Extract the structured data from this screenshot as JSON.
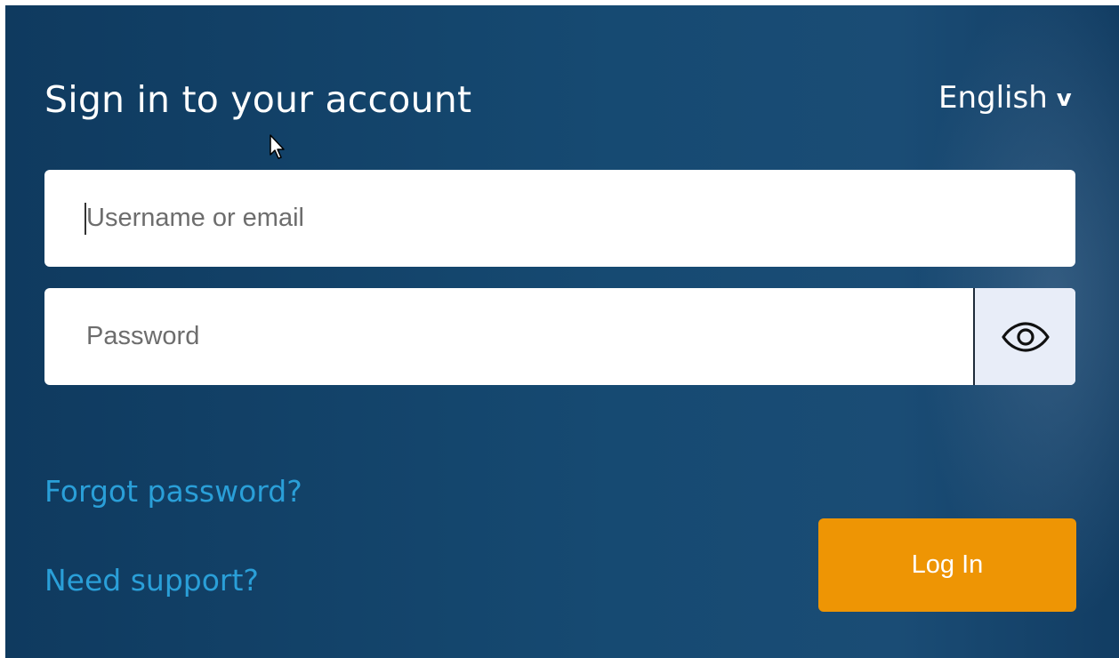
{
  "login": {
    "title": "Sign in to your account",
    "language": {
      "selected": "English",
      "chevron": "v"
    },
    "username": {
      "placeholder": "Username or email",
      "value": ""
    },
    "password": {
      "placeholder": "Password",
      "value": "",
      "toggle_icon": "eye-icon"
    },
    "links": {
      "forgot": "Forgot password?",
      "support": "Need support?"
    },
    "submit_label": "Log In"
  },
  "colors": {
    "background": "#164a72",
    "link": "#2a9fd8",
    "button": "#ee9504",
    "eye_button_bg": "#e8edf8"
  }
}
